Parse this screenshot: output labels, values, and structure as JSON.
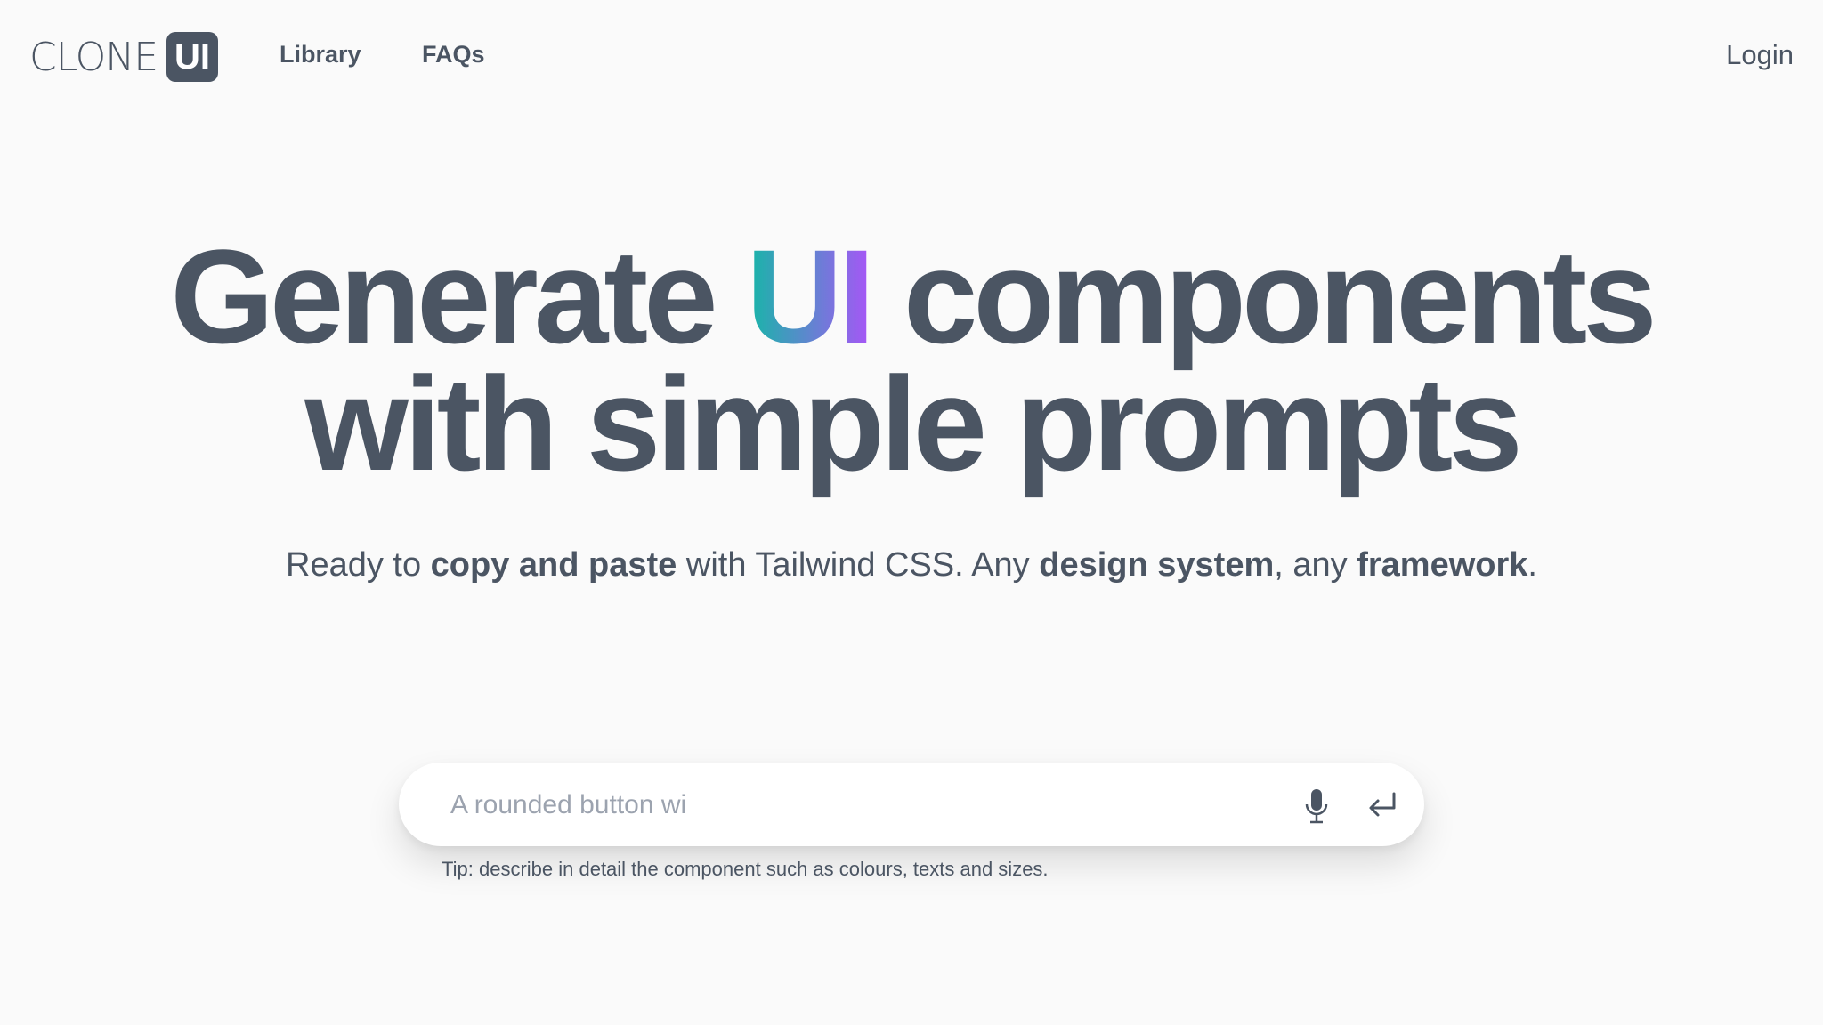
{
  "nav": {
    "logo_text": "CLONE",
    "logo_badge": "UI",
    "links": [
      "Library",
      "FAQs"
    ],
    "login": "Login"
  },
  "hero": {
    "line1_before": "Generate ",
    "line1_highlight": "UI",
    "line1_after": " components",
    "line2": "with simple prompts",
    "gradient_colors": [
      "#14b8a6",
      "#a855f7"
    ]
  },
  "subtitle": {
    "p1": "Ready to ",
    "b1": "copy and paste",
    "p2": " with Tailwind CSS. Any ",
    "b2": "design system",
    "p3": ", any ",
    "b3": "framework",
    "p4": "."
  },
  "search": {
    "placeholder": "A rounded button wi",
    "value": "",
    "mic_icon": "microphone-icon",
    "submit_icon": "enter-icon"
  },
  "tip": "Tip: describe in detail the component such as colours, texts and sizes."
}
